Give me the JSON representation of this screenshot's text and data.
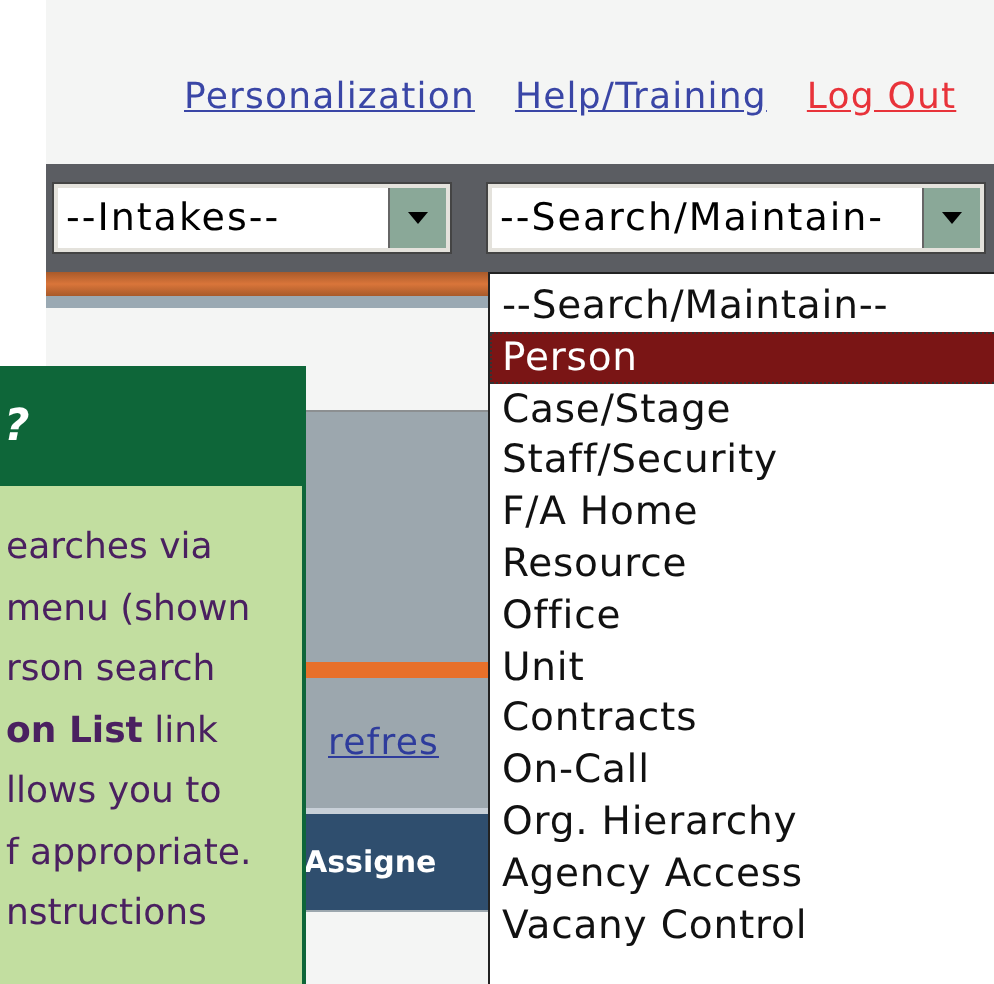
{
  "header_links": [
    {
      "label": "Personalization",
      "kind": "normal"
    },
    {
      "label": "Help/Training",
      "kind": "normal"
    },
    {
      "label": "Log Out",
      "kind": "logout"
    }
  ],
  "intakes_select": {
    "value": "--Intakes--"
  },
  "search_select": {
    "value": "--Search/Maintain-",
    "options": [
      {
        "label": "--Search/Maintain--",
        "selected": false
      },
      {
        "label": "Person",
        "selected": true
      },
      {
        "label": "Case/Stage",
        "selected": false
      },
      {
        "label": "Staff/Security",
        "selected": false
      },
      {
        "label": "F/A Home",
        "selected": false
      },
      {
        "label": "Resource",
        "selected": false
      },
      {
        "label": "Office",
        "selected": false
      },
      {
        "label": "Unit",
        "selected": false
      },
      {
        "label": "Contracts",
        "selected": false
      },
      {
        "label": "On-Call",
        "selected": false
      },
      {
        "label": "Org. Hierarchy",
        "selected": false
      },
      {
        "label": "Agency Access",
        "selected": false
      },
      {
        "label": "Vacany Control",
        "selected": false
      }
    ]
  },
  "panel": {
    "link": "refres",
    "bar_title": "Assigne"
  },
  "callout": {
    "title": "?",
    "lines": [
      "earches via",
      "menu (shown",
      "rson search",
      "**on List** link",
      "llows you to",
      "f appropriate.",
      "nstructions"
    ]
  }
}
